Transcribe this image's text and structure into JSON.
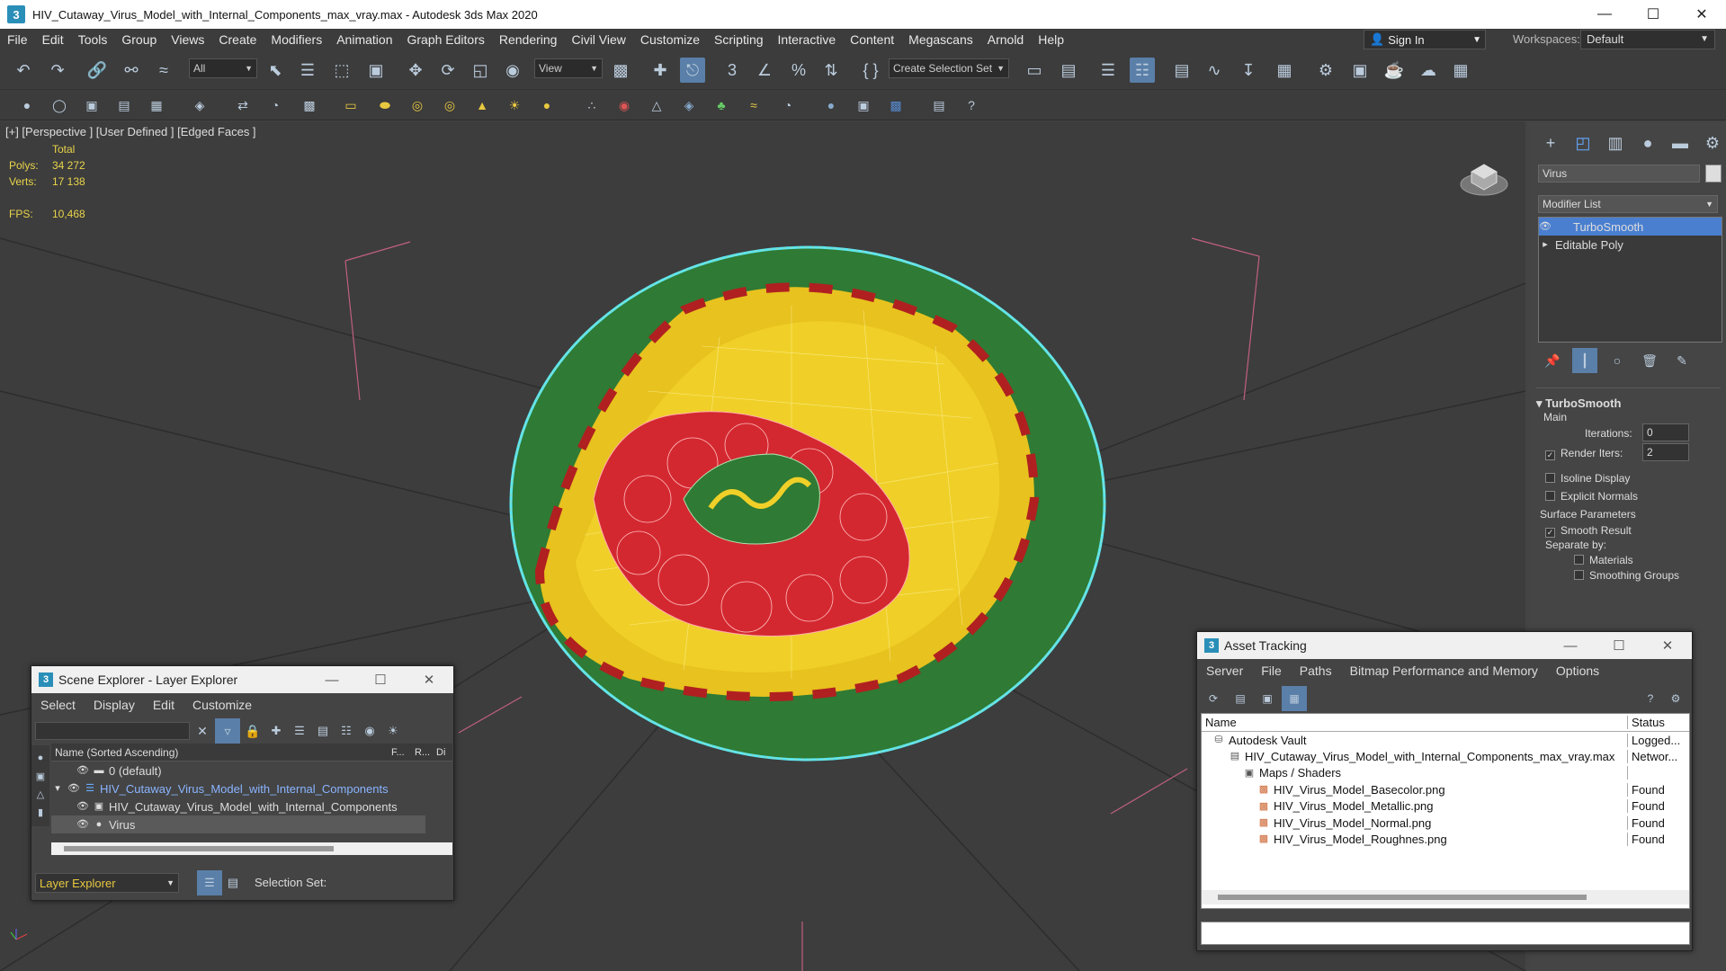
{
  "window": {
    "title": "HIV_Cutaway_Virus_Model_with_Internal_Components_max_vray.max - Autodesk 3ds Max 2020",
    "app_icon": "3"
  },
  "menu": [
    "File",
    "Edit",
    "Tools",
    "Group",
    "Views",
    "Create",
    "Modifiers",
    "Animation",
    "Graph Editors",
    "Rendering",
    "Civil View",
    "Customize",
    "Scripting",
    "Interactive",
    "Content",
    "Megascans",
    "Arnold",
    "Help"
  ],
  "signin": "Sign In",
  "workspaces": {
    "label": "Workspaces:",
    "value": "Default"
  },
  "toolbar": {
    "selection_filter": "All",
    "ref_coord": "View",
    "create_selection_set": "Create Selection Set"
  },
  "viewport": {
    "label": "[+] [Perspective ] [User Defined ] [Edged Faces ]",
    "stats": {
      "total_label": "Total",
      "polys_label": "Polys:",
      "polys": "34 272",
      "verts_label": "Verts:",
      "verts": "17 138",
      "fps_label": "FPS:",
      "fps": "10,468"
    }
  },
  "command_panel": {
    "object_name": "Virus",
    "modifier_list": "Modifier List",
    "stack": [
      "TurboSmooth",
      "Editable Poly"
    ],
    "rollout_title": "TurboSmooth",
    "main_label": "Main",
    "iterations_label": "Iterations:",
    "iterations": "0",
    "render_iters_label": "Render Iters:",
    "render_iters": "2",
    "isoline": "Isoline Display",
    "explicit_normals": "Explicit Normals",
    "surface_params": "Surface Parameters",
    "smooth_result": "Smooth Result",
    "separate_by": "Separate by:",
    "materials": "Materials",
    "smoothing_groups": "Smoothing Groups"
  },
  "scene_explorer": {
    "title": "Scene Explorer - Layer Explorer",
    "menu": [
      "Select",
      "Display",
      "Edit",
      "Customize"
    ],
    "columns": {
      "name": "Name (Sorted Ascending)",
      "f": "F...",
      "r": "R...",
      "d": "Di"
    },
    "rows": [
      "0 (default)",
      "HIV_Cutaway_Virus_Model_with_Internal_Components",
      "HIV_Cutaway_Virus_Model_with_Internal_Components",
      "Virus"
    ],
    "footer_label": "Layer Explorer",
    "selection_set": "Selection Set:"
  },
  "asset_tracking": {
    "title": "Asset Tracking",
    "menu": [
      "Server",
      "File",
      "Paths",
      "Bitmap Performance and Memory",
      "Options"
    ],
    "columns": {
      "name": "Name",
      "status": "Status"
    },
    "rows": [
      {
        "name": "Autodesk Vault",
        "status": "Logged..."
      },
      {
        "name": "HIV_Cutaway_Virus_Model_with_Internal_Components_max_vray.max",
        "status": "Networ..."
      },
      {
        "name": "Maps / Shaders",
        "status": ""
      },
      {
        "name": "HIV_Virus_Model_Basecolor.png",
        "status": "Found"
      },
      {
        "name": "HIV_Virus_Model_Metallic.png",
        "status": "Found"
      },
      {
        "name": "HIV_Virus_Model_Normal.png",
        "status": "Found"
      },
      {
        "name": "HIV_Virus_Model_Roughnes.png",
        "status": "Found"
      }
    ]
  },
  "colors": {
    "accent": "#2a8fb8",
    "stats": "#e8d44a",
    "selection": "#4a7fd0"
  }
}
